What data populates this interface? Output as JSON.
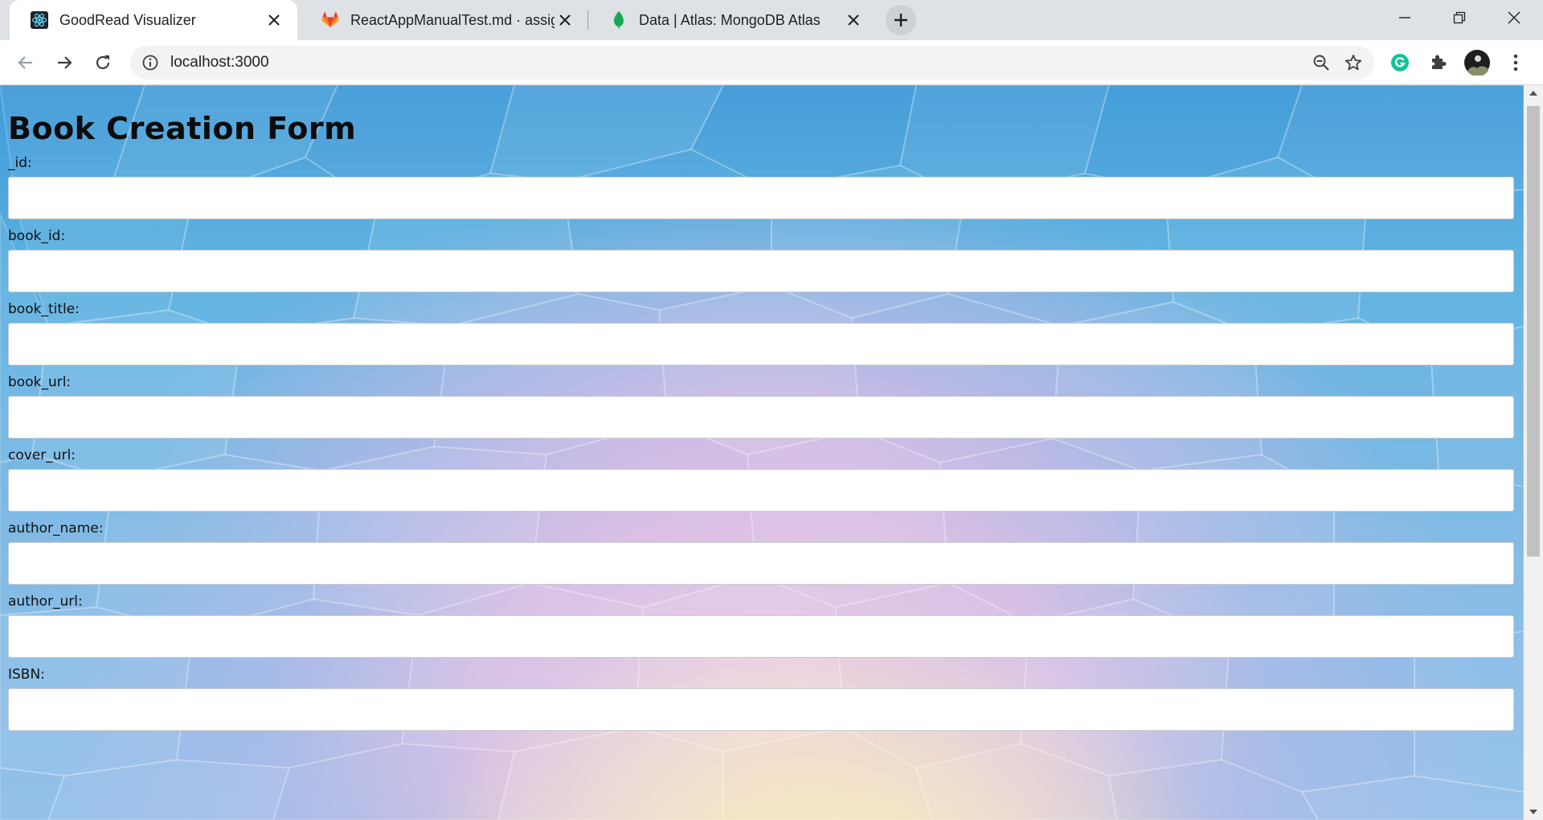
{
  "browser": {
    "tabs": [
      {
        "title": "GoodRead Visualizer",
        "icon": "react-icon",
        "active": true
      },
      {
        "title": "ReactAppManualTest.md · assign",
        "icon": "gitlab-icon",
        "active": false
      },
      {
        "title": "Data | Atlas: MongoDB Atlas",
        "icon": "mongodb-leaf-icon",
        "active": false
      }
    ],
    "new_tab_label": "+",
    "url": "localhost:3000",
    "colors": {
      "tab_strip": "#dee1e6",
      "omnibox": "#f1f3f4",
      "grammarly": "#15c39a",
      "gitlab": "#e24329",
      "mongodb": "#13aa52",
      "react": "#61dafb"
    }
  },
  "page": {
    "heading": "Book Creation Form",
    "fields": [
      {
        "label": "_id:",
        "value": ""
      },
      {
        "label": "book_id:",
        "value": ""
      },
      {
        "label": "book_title:",
        "value": ""
      },
      {
        "label": "book_url:",
        "value": ""
      },
      {
        "label": "cover_url:",
        "value": ""
      },
      {
        "label": "author_name:",
        "value": ""
      },
      {
        "label": "author_url:",
        "value": ""
      },
      {
        "label": "ISBN:",
        "value": ""
      }
    ]
  }
}
